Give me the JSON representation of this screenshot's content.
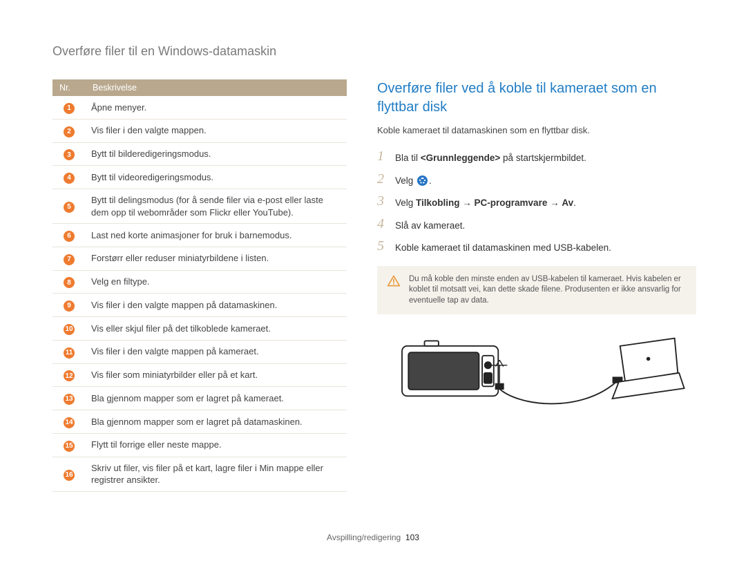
{
  "page_title": "Overføre filer til en Windows-datamaskin",
  "table": {
    "header_nr": "Nr.",
    "header_desc": "Beskrivelse",
    "rows": [
      {
        "n": "1",
        "text": "Åpne menyer."
      },
      {
        "n": "2",
        "text": "Vis filer i den valgte mappen."
      },
      {
        "n": "3",
        "text": "Bytt til bilderedigeringsmodus."
      },
      {
        "n": "4",
        "text": "Bytt til videoredigeringsmodus."
      },
      {
        "n": "5",
        "text": "Bytt til delingsmodus (for å sende filer via e-post eller laste dem opp til webområder som Flickr eller YouTube)."
      },
      {
        "n": "6",
        "text": "Last ned korte animasjoner for bruk i barnemodus."
      },
      {
        "n": "7",
        "text": "Forstørr eller reduser miniatyrbildene i listen."
      },
      {
        "n": "8",
        "text": "Velg en filtype."
      },
      {
        "n": "9",
        "text": "Vis filer i den valgte mappen på datamaskinen."
      },
      {
        "n": "10",
        "text": "Vis eller skjul filer på det tilkoblede kameraet."
      },
      {
        "n": "11",
        "text": "Vis filer i den valgte mappen på kameraet."
      },
      {
        "n": "12",
        "text": "Vis filer som miniatyrbilder eller på et kart."
      },
      {
        "n": "13",
        "text": "Bla gjennom mapper som er lagret på kameraet."
      },
      {
        "n": "14",
        "text": "Bla gjennom mapper som er lagret på datamaskinen."
      },
      {
        "n": "15",
        "text": "Flytt til forrige eller neste mappe."
      },
      {
        "n": "16",
        "text": "Skriv ut filer, vis filer på et kart, lagre filer i Min mappe eller registrer ansikter."
      }
    ]
  },
  "section_heading": "Overføre filer ved å koble til kameraet som en flyttbar disk",
  "intro_text": "Koble kameraet til datamaskinen som en flyttbar disk.",
  "steps": {
    "s1_a": "Bla til ",
    "s1_b": "<Grunnleggende>",
    "s1_c": " på startskjermbildet.",
    "s2_a": "Velg ",
    "s2_b": ".",
    "s3_a": "Velg ",
    "s3_b": "Tilkobling",
    "s3_arrow1": " → ",
    "s3_c": "PC-programvare",
    "s3_arrow2": " → ",
    "s3_d": "Av",
    "s3_e": ".",
    "s4": "Slå av kameraet.",
    "s5": "Koble kameraet til datamaskinen med USB-kabelen."
  },
  "note_text": "Du må koble den minste enden av USB-kabelen til kameraet. Hvis kabelen er koblet til motsatt vei, kan dette skade filene. Produsenten er ikke ansvarlig for eventuelle tap av data.",
  "footer_section": "Avspilling/redigering",
  "footer_page": "103"
}
